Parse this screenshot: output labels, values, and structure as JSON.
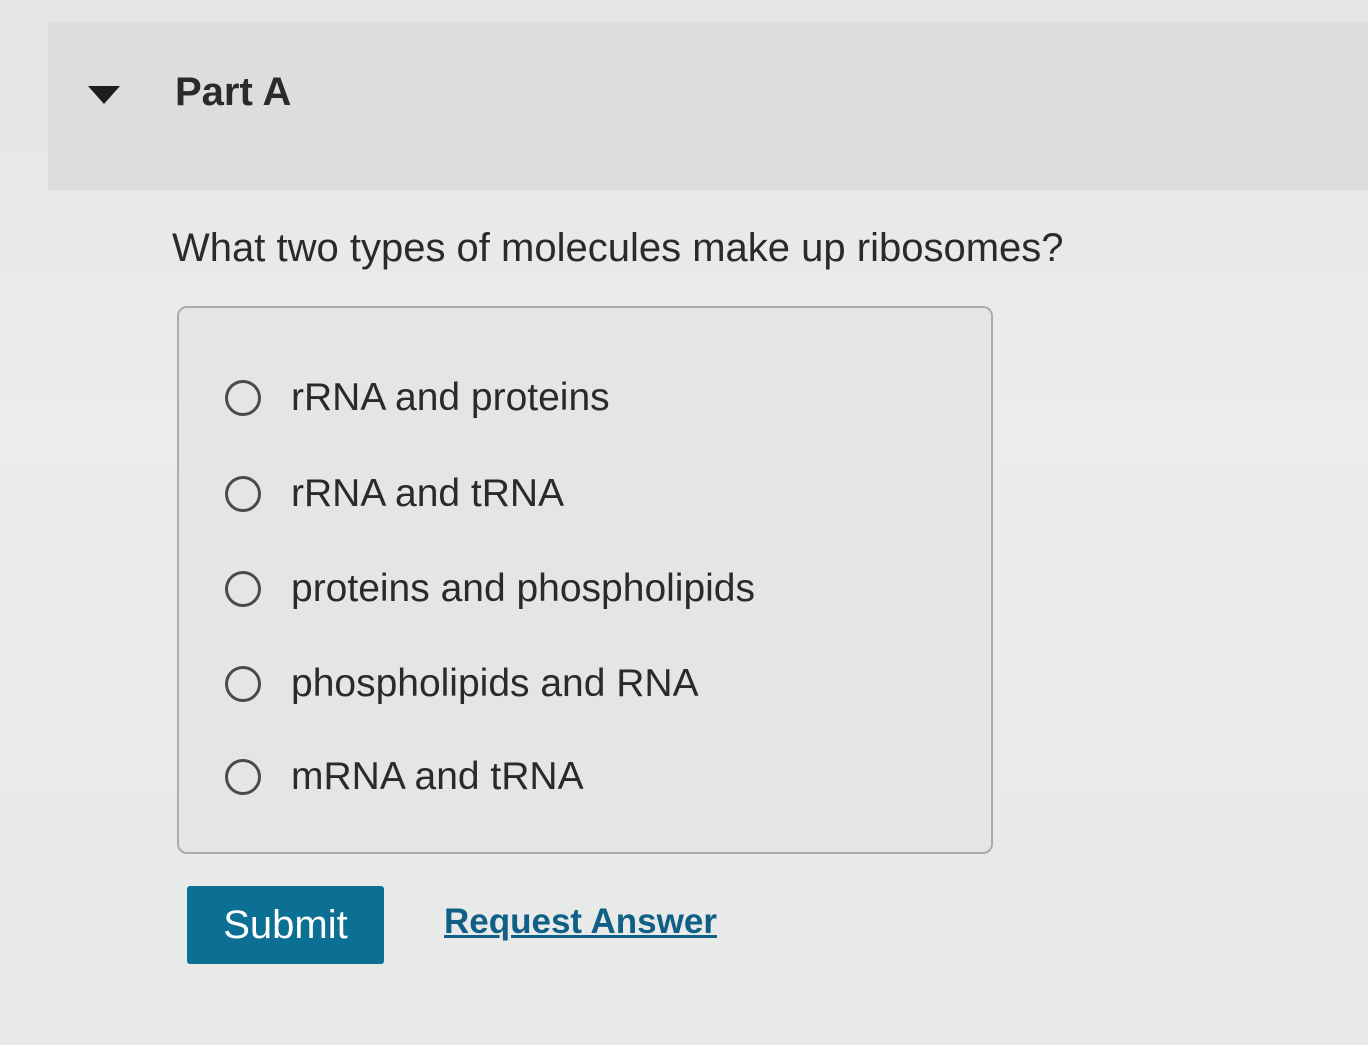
{
  "part": {
    "title": "Part A"
  },
  "question": {
    "text": "What two types of molecules make up ribosomes?"
  },
  "options": [
    {
      "label": "rRNA and proteins"
    },
    {
      "label": "rRNA and tRNA"
    },
    {
      "label": "proteins and phospholipids"
    },
    {
      "label": "phospholipids and RNA"
    },
    {
      "label": "mRNA and tRNA"
    }
  ],
  "actions": {
    "submit_label": "Submit",
    "request_answer_label": "Request Answer"
  },
  "icons": {
    "collapse": "caret-down-icon",
    "radio": "radio-unselected-icon"
  },
  "colors": {
    "submit_bg": "#0c6f94",
    "link": "#0f5f86"
  }
}
